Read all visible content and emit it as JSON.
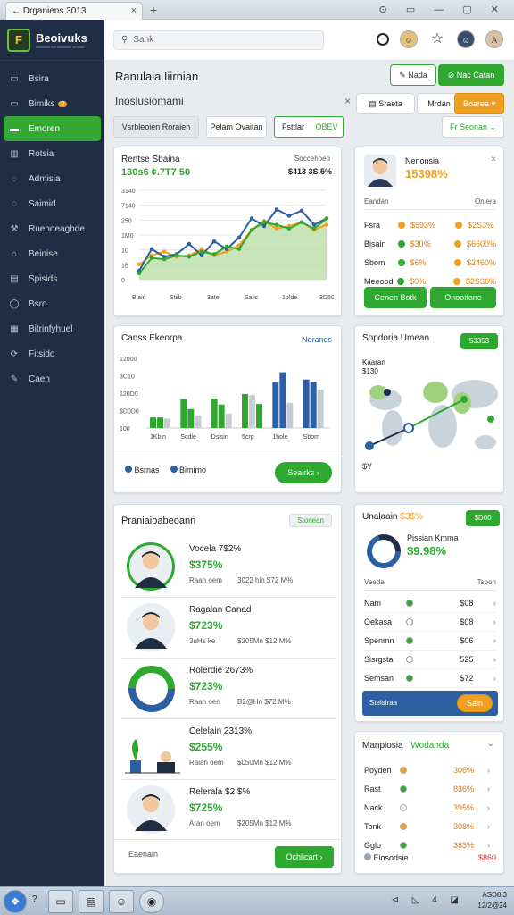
{
  "browser": {
    "tab_title": "Drganiens 3013",
    "close": "×",
    "new_tab": "+",
    "controls": "⊙ ▭ — ▢ ✕"
  },
  "app": {
    "name": "Beoivuks",
    "tagline": "xxxxxxxx xxx xxxxxxxx xx xxxx",
    "logo_letter": "F"
  },
  "sidebar": {
    "items": [
      {
        "label": "Bsira",
        "icon": "window-icon"
      },
      {
        "label": "Bimiks",
        "icon": "window-icon",
        "badge": "?"
      },
      {
        "label": "Emoren",
        "icon": "card-icon",
        "active": true
      },
      {
        "label": "Rotsia",
        "icon": "bar-icon"
      },
      {
        "label": "Admisia",
        "icon": "chat-icon"
      },
      {
        "label": "Saimid",
        "icon": "chat-icon"
      },
      {
        "label": "Ruenoeagbde",
        "icon": "wrench-icon"
      },
      {
        "label": "Beinise",
        "icon": "home-icon"
      },
      {
        "label": "Spisids",
        "icon": "doc-icon"
      },
      {
        "label": "Bsro",
        "icon": "circle-icon"
      },
      {
        "label": "Bitrinfyhuel",
        "icon": "folder-icon"
      },
      {
        "label": "Fitsido",
        "icon": "refresh-icon"
      },
      {
        "label": "Caen",
        "icon": "pen-icon"
      }
    ]
  },
  "topbar": {
    "search_placeholder": "Sank",
    "avatar_letter": "A"
  },
  "header": {
    "title": "Ranulaia Iiirnian",
    "btn_secondary": "Nada",
    "btn_primary": "Nac Catan",
    "filter_title": "Inoslusiomami",
    "filter_close": "×",
    "chips": [
      "Vsrbleoien Roraien",
      "Pelam Ovaitan",
      "Fsttlar",
      "OBEV"
    ],
    "right_filter": [
      "Sraeta",
      "Mrdan",
      "Boarea"
    ],
    "right_select": "Fr Seonan"
  },
  "colors": {
    "accent": "#2ea82f",
    "navy": "#1f2d45",
    "blue": "#2d5fa3",
    "orange": "#f0a020"
  },
  "chart_line": {
    "title": "Rentse Sbaina",
    "headline": "130s6 ¢.7T7 50",
    "right_label": "Soccehoeo",
    "right_value": "$413 3S.5%",
    "chart_data": {
      "type": "line",
      "x": [
        "Biain",
        "Stiib",
        "3ate",
        "Salic",
        "1blde",
        "3D50"
      ],
      "ylim": [
        0,
        350
      ],
      "yticks": [
        "3140",
        "7140",
        "250",
        "1M0",
        "10",
        "1B",
        "0"
      ],
      "series": [
        {
          "name": "",
          "values": [
            60,
            95,
            110,
            90,
            95,
            120,
            95,
            110,
            135,
            195,
            230,
            200,
            210,
            225,
            195,
            215
          ]
        },
        {
          "name": "",
          "values": [
            35,
            120,
            90,
            100,
            140,
            95,
            150,
            120,
            165,
            240,
            210,
            275,
            250,
            270,
            215,
            240
          ]
        },
        {
          "name": "",
          "values": [
            25,
            85,
            80,
            95,
            90,
            110,
            100,
            130,
            120,
            195,
            225,
            215,
            200,
            225,
            200,
            240
          ]
        }
      ]
    }
  },
  "profile": {
    "name": "Nenonsia",
    "amount": "15398%",
    "close": "×",
    "col1": "Eandan",
    "col2": "Onlera",
    "rows": [
      {
        "label": "Fsra",
        "a": "$593%",
        "b": "$2S3%"
      },
      {
        "label": "Bisain",
        "a": "$30%",
        "b": "$6600%"
      },
      {
        "label": "Sbom",
        "a": "$6%",
        "b": "$2460%"
      },
      {
        "label": "Meeood",
        "a": "$0%",
        "b": "$2S36%"
      }
    ],
    "btn1": "Cenen Botk",
    "btn2": "Onooitone"
  },
  "bar_card": {
    "title": "Canss Ekeorpa",
    "link": "Neranes",
    "chart_data": {
      "type": "bar",
      "categories": [
        "1Kbin",
        "Scdle",
        "Dsisin",
        "5crp",
        "1hole",
        "Sbom"
      ],
      "ylim": [
        0,
        1250
      ],
      "yticks": [
        "12000",
        "3C10",
        "120D0",
        "$D0D0",
        "100"
      ],
      "series": [
        {
          "name": "Bsrnas",
          "values": [
            190,
            520,
            530,
            610,
            830,
            870
          ]
        },
        {
          "name": "Bimimo",
          "values": [
            190,
            340,
            420,
            590,
            1000,
            830
          ]
        },
        {
          "name": "",
          "values": [
            170,
            230,
            260,
            430,
            450,
            690
          ]
        }
      ]
    },
    "button": "Sealrks"
  },
  "map_card": {
    "title": "Sopdoria Umean",
    "badge": "53353",
    "label1": "Kaaran",
    "label2": "$130",
    "pin": "$Y"
  },
  "list_card": {
    "title": "Praniaioabeoann",
    "badge": "Stonean",
    "items": [
      {
        "title": "Vocela  7$2%",
        "value": "$375%",
        "meta": "Raan oem",
        "meta2": "3022 hin  $72 M%"
      },
      {
        "title": "Ragalan  Canad",
        "value": "$723%",
        "meta": "3ɑHs  ke",
        "meta2": "$205Mn  $12 M%"
      },
      {
        "title": "Rolerdie  2673%",
        "value": "$723%",
        "meta": "Raan oen",
        "meta2": "B2@Hn  $72 M%"
      },
      {
        "title": "Celelain  2313%",
        "value": "$255%",
        "meta": "Ralan oem",
        "meta2": "$050Mn  $12 M%"
      },
      {
        "title": "Relerala  $2 $%",
        "value": "$725%",
        "meta": "Aran oem",
        "meta2": "$205Mn  $12 M%"
      }
    ],
    "footer_label": "Eaenain",
    "footer_button": "Ochlicart"
  },
  "stats_card": {
    "title": "Unalaain",
    "pct": "$3$%",
    "badge": "$D00",
    "donut_title": "Pissian  Kmma",
    "donut_value": "$9.98%",
    "col1": "Veeda",
    "col2": "Tsbon",
    "rows": [
      {
        "label": "Nam",
        "value": "$08"
      },
      {
        "label": "Oekasa",
        "value": "$08"
      },
      {
        "label": "Spenmn",
        "value": "$06"
      },
      {
        "label": "Sisrgsta",
        "value": "525"
      },
      {
        "label": "Semsan",
        "value": "$72"
      }
    ],
    "footer_label": "Steisiraa",
    "footer_button": "Sain"
  },
  "mini_card": {
    "title": "Manpiosia",
    "title2": "Wodanda",
    "rows": [
      {
        "label": "Poyden",
        "value": "306%"
      },
      {
        "label": "Rast",
        "value": "836%"
      },
      {
        "label": "Nack",
        "value": "395%"
      },
      {
        "label": "Tonk",
        "value": "308%"
      },
      {
        "label": "Gglo",
        "value": "383%"
      }
    ],
    "footer_label": "Eiosodsie",
    "footer_value": "$860"
  },
  "taskbar": {
    "time": "ASD8I3",
    "date": "12/2@24",
    "tray": "⊲ ◺ 4 ◪"
  }
}
